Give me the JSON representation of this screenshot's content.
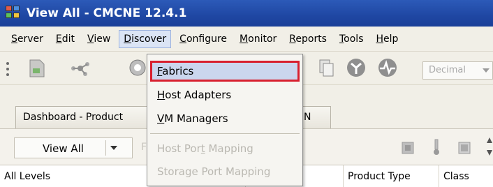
{
  "window": {
    "title": "View All - CMCNE 12.4.1",
    "icon": "app-grid-icon"
  },
  "menubar": {
    "items": [
      {
        "label": "Server",
        "mnemonic": "S",
        "rest": "erver"
      },
      {
        "label": "Edit",
        "mnemonic": "E",
        "rest": "dit"
      },
      {
        "label": "View",
        "mnemonic": "V",
        "rest": "iew"
      },
      {
        "label": "Discover",
        "mnemonic": "D",
        "rest": "iscover"
      },
      {
        "label": "Configure",
        "mnemonic": "C",
        "rest": "onfigure"
      },
      {
        "label": "Monitor",
        "mnemonic": "M",
        "rest": "onitor"
      },
      {
        "label": "Reports",
        "mnemonic": "R",
        "rest": "eports"
      },
      {
        "label": "Tools",
        "mnemonic": "T",
        "rest": "ools"
      },
      {
        "label": "Help",
        "mnemonic": "H",
        "rest": "elp"
      }
    ],
    "open_menu": "Discover"
  },
  "toolbar": {
    "number_format": "Decimal"
  },
  "tabs": {
    "dashboard": "Dashboard - Product",
    "san": "N"
  },
  "filter": {
    "view_label": "View All",
    "faded_letter": "F"
  },
  "table": {
    "columns": [
      "All Levels",
      "Product Type",
      "Class"
    ]
  },
  "dropdown": {
    "items": [
      {
        "label": "Fabrics",
        "mnemonic": "F",
        "rest": "abrics",
        "enabled": true,
        "outlined": true
      },
      {
        "label": "Host Adapters",
        "mnemonic": "H",
        "rest": "ost Adapters",
        "enabled": true
      },
      {
        "label": "VM Managers",
        "mnemonic": "V",
        "rest": "M Managers",
        "enabled": true
      },
      {
        "label": "Host Port Mapping",
        "pre": "Host Por",
        "mnemonic": "t",
        "rest": " Mapping",
        "enabled": false
      },
      {
        "label": "Storage Port Mapping",
        "pre": "Storage Port Mapping",
        "enabled": false
      }
    ]
  },
  "colors": {
    "titlebar": "#1f47a3",
    "menu_highlight": "#cbd6ee",
    "annotation_box": "#d8202f"
  }
}
